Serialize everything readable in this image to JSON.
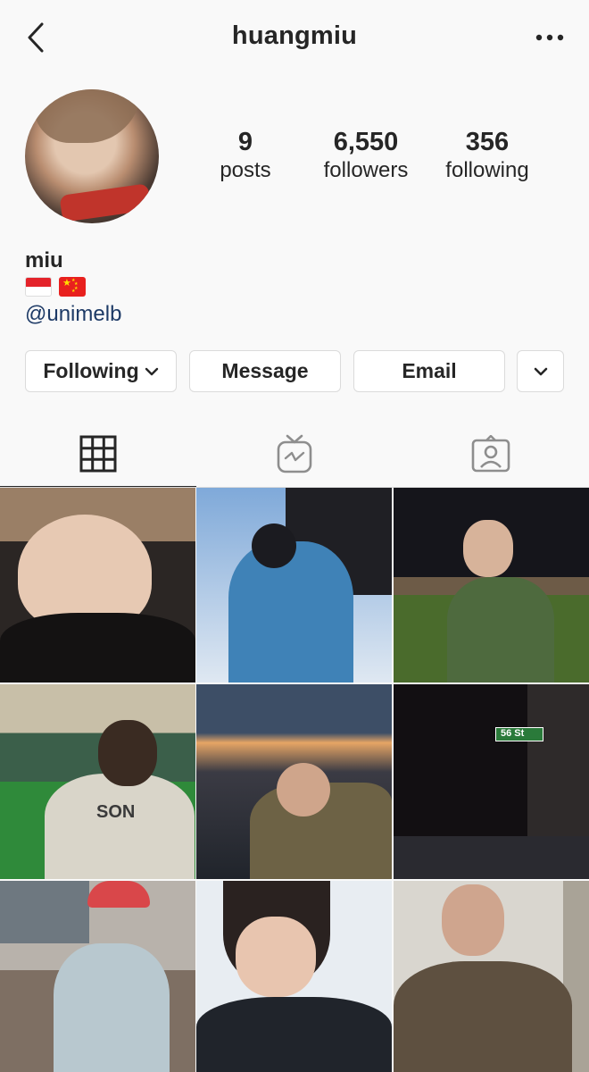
{
  "header": {
    "title": "huangmiu",
    "back_icon": "chevron-left-icon",
    "more_icon": "ellipsis-icon"
  },
  "profile": {
    "stats": [
      {
        "value": "9",
        "label": "posts"
      },
      {
        "value": "6,550",
        "label": "followers"
      },
      {
        "value": "356",
        "label": "following"
      }
    ],
    "name": "miu",
    "flags": [
      "indonesia-flag",
      "china-flag"
    ],
    "handle": "@unimelb"
  },
  "actions": {
    "following_label": "Following",
    "message_label": "Message",
    "email_label": "Email",
    "more_icon": "chevron-down-icon"
  },
  "tabs": [
    {
      "icon": "grid-icon",
      "active": true
    },
    {
      "icon": "igtv-icon",
      "active": false
    },
    {
      "icon": "tagged-icon",
      "active": false
    }
  ],
  "grid": {
    "posts": [
      {
        "subject": "hand-over-face"
      },
      {
        "subject": "blue-jacket-selfie"
      },
      {
        "subject": "night-park-portrait"
      },
      {
        "subject": "stadium-jersey",
        "text": "SON"
      },
      {
        "subject": "sunset-city-view"
      },
      {
        "subject": "night-street",
        "text": "56 St"
      },
      {
        "subject": "record-store"
      },
      {
        "subject": "snow-selfie"
      },
      {
        "subject": "mirror-selfie"
      }
    ]
  },
  "colors": {
    "background": "#f9f9f9",
    "text": "#262626",
    "link": "#1d3a66",
    "border": "#dbdbdb"
  }
}
